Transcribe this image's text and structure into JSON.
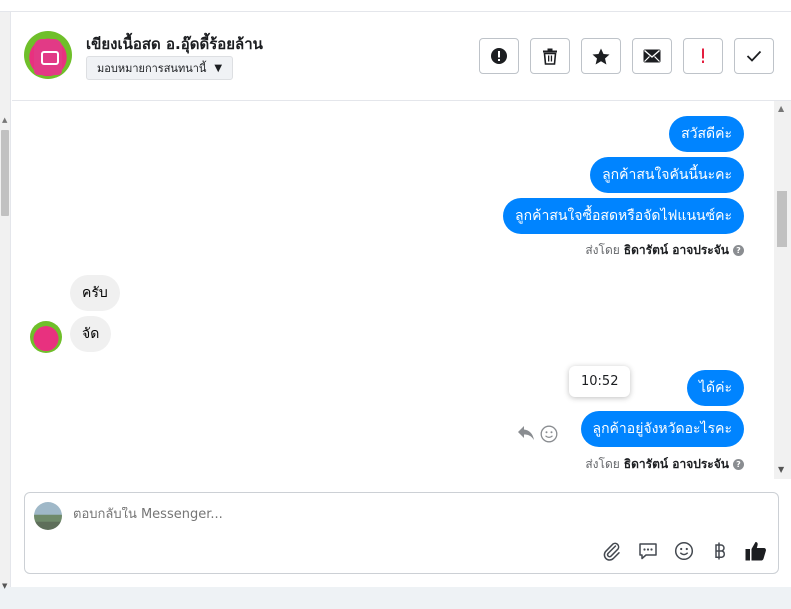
{
  "header": {
    "contact_name": "เขียงเนื้อสด อ.อุ๊ดดี้ร้อยล้าน",
    "assign_label": "มอบหมายการสนทนานี้"
  },
  "conversation": {
    "messages_out_1": [
      "สวัสดีค่ะ",
      "ลูกค้าสนใจคันนี้นะคะ",
      "ลูกค้าสนใจซื้อสดหรือจัดไฟแนนซ์คะ"
    ],
    "sent_by_prefix": "ส่งโดย",
    "sent_by_name": "ธิดารัตน์ อาจประจัน",
    "messages_in": [
      "ครับ",
      "จัด"
    ],
    "tooltip_time": "10:52",
    "messages_out_2": [
      "ได้ค่ะ",
      "ลูกค้าอยู่จังหวัดอะไรคะ"
    ]
  },
  "composer": {
    "placeholder": "ตอบกลับใน Messenger..."
  },
  "colors": {
    "outgoing_bubble": "#0084ff",
    "incoming_bubble": "#f0f0f0",
    "important_red": "#e41e3f"
  },
  "icons": {
    "header_actions": [
      "alert-circle-icon",
      "trash-icon",
      "star-icon",
      "envelope-icon",
      "exclamation-icon",
      "check-icon"
    ],
    "composer_tools": [
      "paperclip-icon",
      "speech-bubble-icon",
      "smiley-icon",
      "baht-icon",
      "thumbs-up-icon"
    ]
  }
}
